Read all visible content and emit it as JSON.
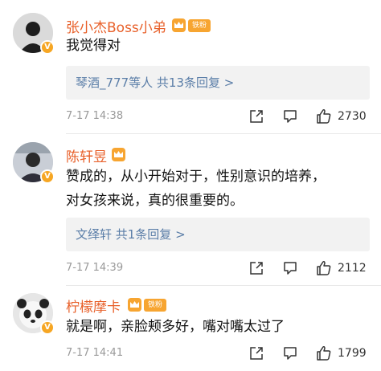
{
  "comments": [
    {
      "username": "张小杰Boss小弟",
      "fan_badge": "铁粉",
      "text_lines": [
        "我觉得对"
      ],
      "reply_summary": "琴酒_777等人  共13条回复 >",
      "time": "7-17 14:38",
      "likes": "2730"
    },
    {
      "username": "陈轩昱",
      "fan_badge": "",
      "text_lines": [
        "赞成的，从小开始对于，性别意识的培养，",
        "对女孩来说，真的很重要的。"
      ],
      "reply_summary": "文绎轩  共1条回复 >",
      "time": "7-17 14:39",
      "likes": "2112"
    },
    {
      "username": "柠檬摩卡",
      "fan_badge": "铁粉",
      "text_lines": [
        "就是啊，亲脸颊多好，嘴对嘴太过了"
      ],
      "reply_summary": "",
      "time": "7-17 14:41",
      "likes": "1799"
    }
  ],
  "colors": {
    "username": "#e8602a",
    "reply_link": "#5b7ea8",
    "badge": "#f6a623"
  },
  "icons": [
    "share-icon",
    "comment-icon",
    "like-icon",
    "crown-badge-icon",
    "verified-badge-icon"
  ]
}
